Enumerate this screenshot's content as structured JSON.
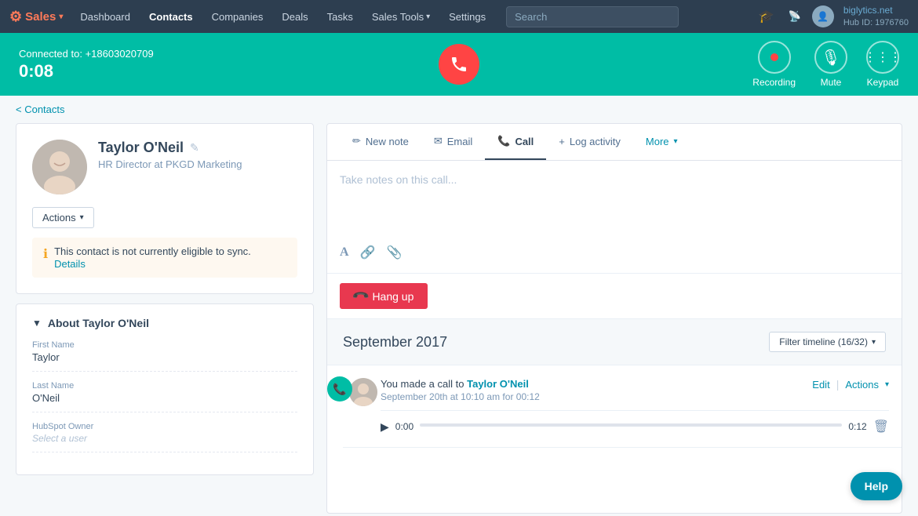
{
  "nav": {
    "brand": "Sales",
    "items": [
      "Dashboard",
      "Contacts",
      "Companies",
      "Deals",
      "Tasks",
      "Sales Tools",
      "Settings"
    ],
    "active_item": "Contacts",
    "search_placeholder": "Search",
    "user": {
      "company": "biglytics.net",
      "hub_id": "Hub ID: 1976760"
    }
  },
  "call_bar": {
    "connected_label": "Connected to:",
    "phone": "+18603020709",
    "timer": "0:08",
    "controls": [
      {
        "name": "Recording",
        "icon": "⏺"
      },
      {
        "name": "Mute",
        "icon": "🎙"
      },
      {
        "name": "Keypad",
        "icon": "⌨"
      }
    ]
  },
  "breadcrumb": {
    "label": "< Contacts"
  },
  "contact": {
    "name": "Taylor O'Neil",
    "title": "HR Director at PKGD Marketing",
    "actions_label": "Actions",
    "sync_warning": "This contact is not currently eligible to sync.",
    "sync_details_link": "Details",
    "about_section_title": "About Taylor O'Neil",
    "fields": [
      {
        "label": "First Name",
        "value": "Taylor"
      },
      {
        "label": "Last Name",
        "value": "O'Neil"
      },
      {
        "label": "HubSpot Owner",
        "value": ""
      }
    ]
  },
  "tabs": [
    {
      "id": "new-note",
      "label": "New note",
      "icon": "✏"
    },
    {
      "id": "email",
      "label": "Email",
      "icon": "✉"
    },
    {
      "id": "call",
      "label": "Call",
      "icon": "📞",
      "active": true
    },
    {
      "id": "log-activity",
      "label": "Log activity",
      "icon": "+"
    },
    {
      "id": "more",
      "label": "More",
      "icon": "▾"
    }
  ],
  "note": {
    "placeholder": "Take notes on this call...",
    "toolbar": [
      "A",
      "🔗",
      "📎"
    ]
  },
  "hang_up": {
    "label": "Hang up",
    "icon": "📞"
  },
  "timeline": {
    "month": "September 2017",
    "filter_label": "Filter timeline (16/32)",
    "items": [
      {
        "text_prefix": "You made a call to",
        "contact_name": "Taylor O'Neil",
        "meta": "September 20th at 10:10 am for 00:12",
        "edit_label": "Edit",
        "actions_label": "Actions",
        "audio_start": "0:00",
        "audio_end": "0:12"
      }
    ]
  },
  "help": {
    "label": "Help"
  }
}
